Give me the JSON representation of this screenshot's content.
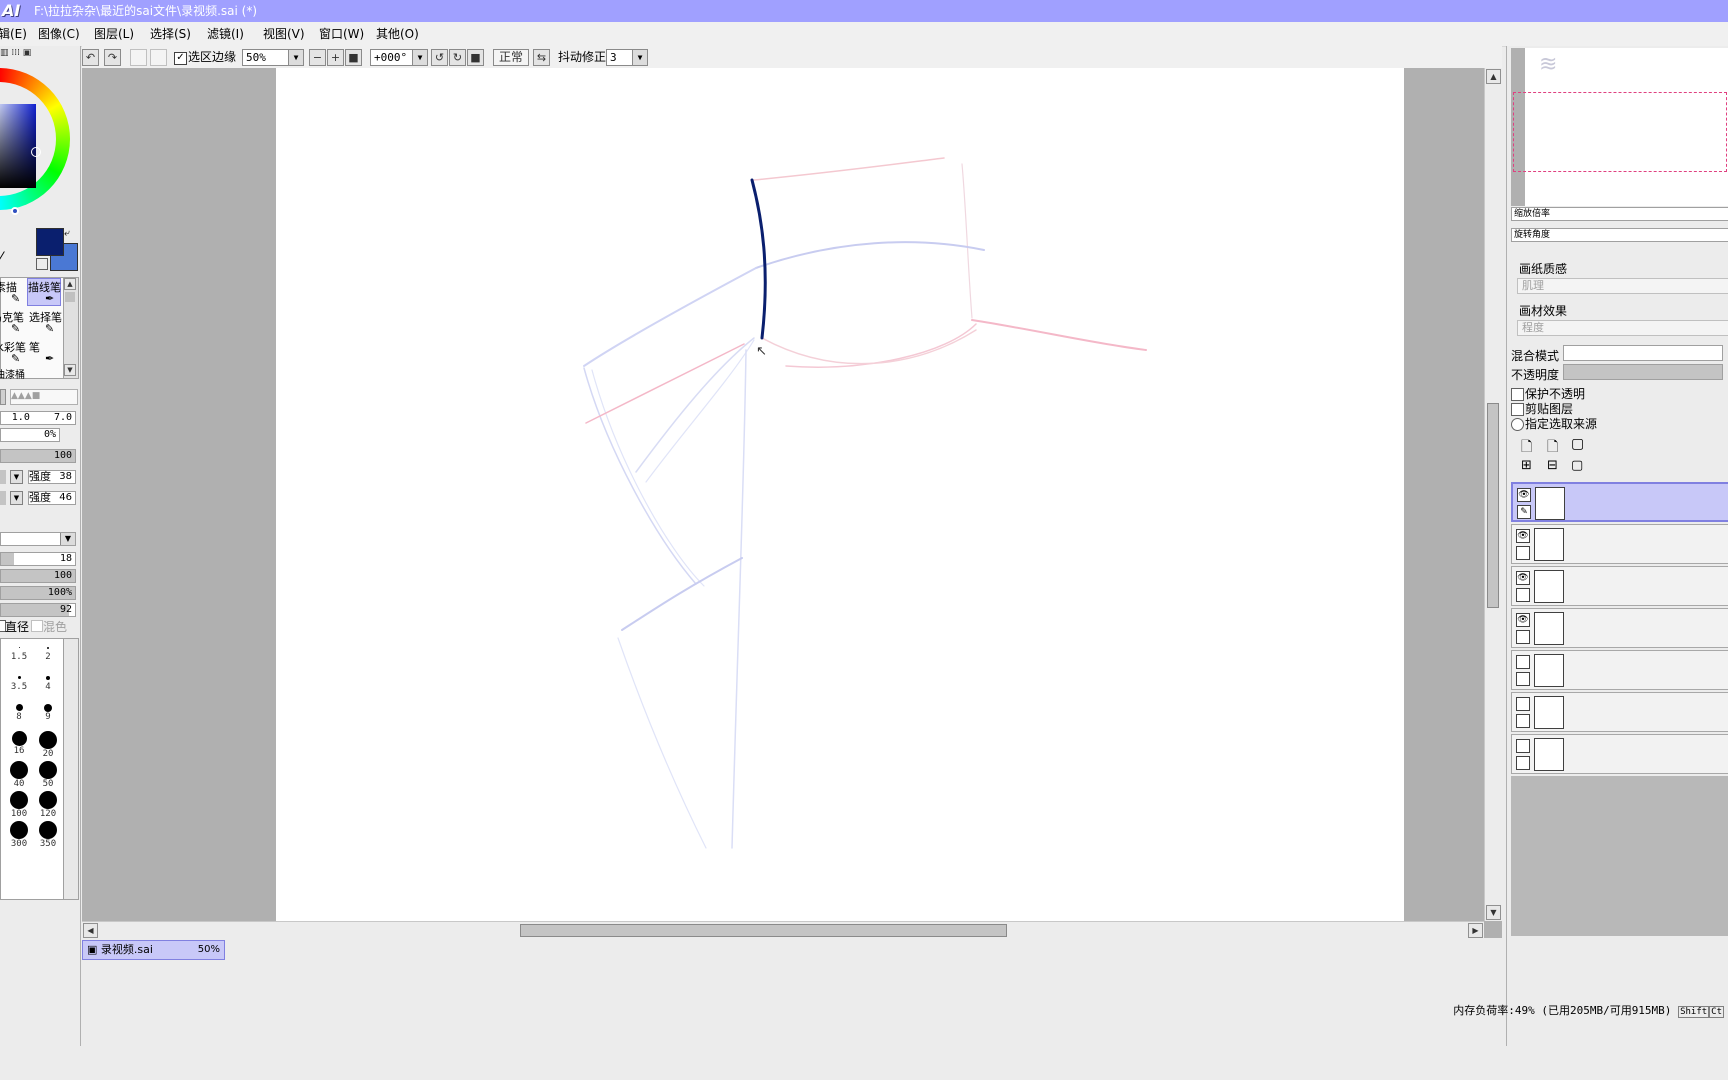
{
  "window": {
    "logo": "AI",
    "title": "F:\\拉拉杂杂\\最近的sai文件\\录视频.sai (*)"
  },
  "menu": [
    {
      "label": "编辑(E)",
      "visible": "辑(E)"
    },
    {
      "label": "图像(C)"
    },
    {
      "label": "图层(L)"
    },
    {
      "label": "选择(S)"
    },
    {
      "label": "滤镜(I)"
    },
    {
      "label": "视图(V)"
    },
    {
      "label": "窗口(W)"
    },
    {
      "label": "其他(O)"
    }
  ],
  "toolbar": {
    "selection_edge_label": "选区边缘",
    "selection_edge_checked": true,
    "zoom": "50%",
    "rotation": "+000°",
    "blend": "正常",
    "stabilizer_label": "抖动修正",
    "stabilizer_value": "3"
  },
  "tools": {
    "items": [
      "素描",
      "描线笔",
      "马克笔",
      "选择笔",
      "水彩笔",
      "笔",
      "油漆桶"
    ],
    "selected": "描线笔"
  },
  "brush": {
    "size_min": "1.0",
    "size_max": "7.0",
    "density_pct": "0%",
    "row_100a": "100",
    "strength1_label": "强度",
    "strength1_value": "38",
    "strength2_label": "强度",
    "strength2_value": "46",
    "val_18": "18",
    "val_100b": "100",
    "val_100pct": "100%",
    "val_92": "92",
    "diameter_label": "直径",
    "blend_label": "混色",
    "sizes": [
      "1.5",
      "2",
      "3.5",
      "4",
      "8",
      "9",
      "16",
      "20",
      "40",
      "50",
      "100",
      "120",
      "300",
      "350"
    ]
  },
  "colors": {
    "primary": "#0a1f6e",
    "secondary": "#4a78d4",
    "titlebar": "#a0a0ff",
    "selection": "#c8c8f8"
  },
  "navigator": {
    "zoom_label": "缩放倍率",
    "rotate_label": "旋转角度"
  },
  "layer_panel": {
    "paper_texture": "画纸质感",
    "paper_texture_value": "肌理",
    "paper_effect": "画材效果",
    "paper_effect_value": "程度",
    "blend_mode": "混合模式",
    "opacity": "不透明度",
    "protect_opacity": "保护不透明",
    "clip_layer": "剪贴图层",
    "selection_source": "指定选取来源",
    "layers": [
      {
        "visible": true,
        "selected": true
      },
      {
        "visible": true,
        "selected": false
      },
      {
        "visible": true,
        "selected": false
      },
      {
        "visible": true,
        "selected": false
      },
      {
        "visible": false,
        "selected": false
      },
      {
        "visible": false,
        "selected": false
      },
      {
        "visible": false,
        "selected": false
      }
    ]
  },
  "tab": {
    "name": "录视频.sai",
    "zoom": "50%"
  },
  "status": {
    "memory": "内存负荷率:49% (已用205MB/可用915MB)",
    "shift": "Shift",
    "ctrl": "Ct"
  }
}
